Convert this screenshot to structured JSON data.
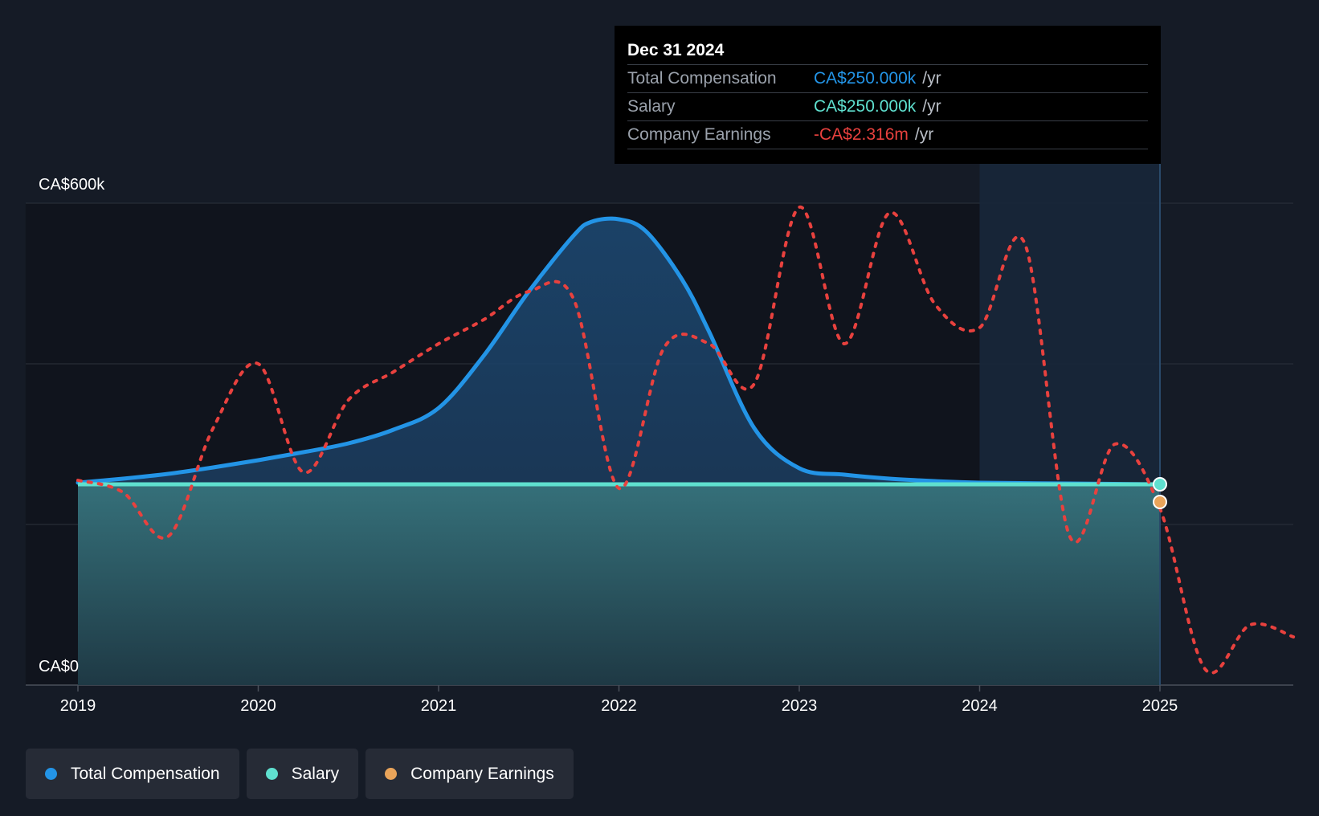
{
  "colors": {
    "background": "#151b26",
    "total_compensation": "#2394e6",
    "salary": "#5fe0cf",
    "earnings": "#e8413e",
    "earnings_marker": "#e9a45a"
  },
  "tooltip": {
    "date": "Dec 31 2024",
    "rows": [
      {
        "label": "Total Compensation",
        "value": "CA$250.000k",
        "suffix": "/yr"
      },
      {
        "label": "Salary",
        "value": "CA$250.000k",
        "suffix": "/yr"
      },
      {
        "label": "Company Earnings",
        "value": "-CA$2.316m",
        "suffix": "/yr"
      }
    ]
  },
  "legend": {
    "items": [
      {
        "label": "Total Compensation"
      },
      {
        "label": "Salary"
      },
      {
        "label": "Company Earnings"
      }
    ]
  },
  "chart_data": {
    "type": "area",
    "title": "",
    "xlabel": "",
    "ylabel": "",
    "x_ticks": [
      "2019",
      "2020",
      "2021",
      "2022",
      "2023",
      "2024",
      "2025"
    ],
    "y_ticks": [
      "CA$0",
      "CA$600k"
    ],
    "xlim": [
      2018.71,
      2025.74
    ],
    "ylim": [
      0,
      600
    ],
    "y_unit": "CA$ thousands",
    "grid": true,
    "legend_position": "bottom-left",
    "highlight_start": 2024.0,
    "cursor_x": 2025.0,
    "series": [
      {
        "name": "Total Compensation",
        "style": "area-line",
        "x": [
          2019.0,
          2019.25,
          2019.5,
          2019.75,
          2020.0,
          2020.25,
          2020.5,
          2020.75,
          2021.0,
          2021.25,
          2021.5,
          2021.75,
          2021.85,
          2022.0,
          2022.15,
          2022.35,
          2022.5,
          2022.75,
          2023.0,
          2023.25,
          2023.5,
          2023.75,
          2024.0,
          2024.5,
          2025.0
        ],
        "values": [
          252,
          257,
          263,
          271,
          280,
          290,
          301,
          318,
          345,
          410,
          490,
          560,
          577,
          580,
          565,
          505,
          440,
          320,
          270,
          262,
          257,
          254,
          252,
          251,
          250
        ]
      },
      {
        "name": "Salary",
        "style": "area-line",
        "x": [
          2019.0,
          2025.0
        ],
        "values": [
          250,
          250
        ]
      },
      {
        "name": "Company Earnings",
        "style": "dotted",
        "x": [
          2019.0,
          2019.25,
          2019.5,
          2019.75,
          2020.0,
          2020.25,
          2020.5,
          2020.75,
          2021.0,
          2021.25,
          2021.5,
          2021.75,
          2022.0,
          2022.25,
          2022.5,
          2022.75,
          2023.0,
          2023.25,
          2023.5,
          2023.75,
          2024.0,
          2024.25,
          2024.5,
          2024.75,
          2025.0,
          2025.25,
          2025.5,
          2025.74
        ],
        "values": [
          255,
          240,
          185,
          320,
          400,
          265,
          355,
          390,
          425,
          455,
          490,
          480,
          245,
          420,
          425,
          375,
          595,
          425,
          588,
          475,
          445,
          550,
          185,
          300,
          220,
          20,
          75,
          60
        ]
      }
    ]
  }
}
